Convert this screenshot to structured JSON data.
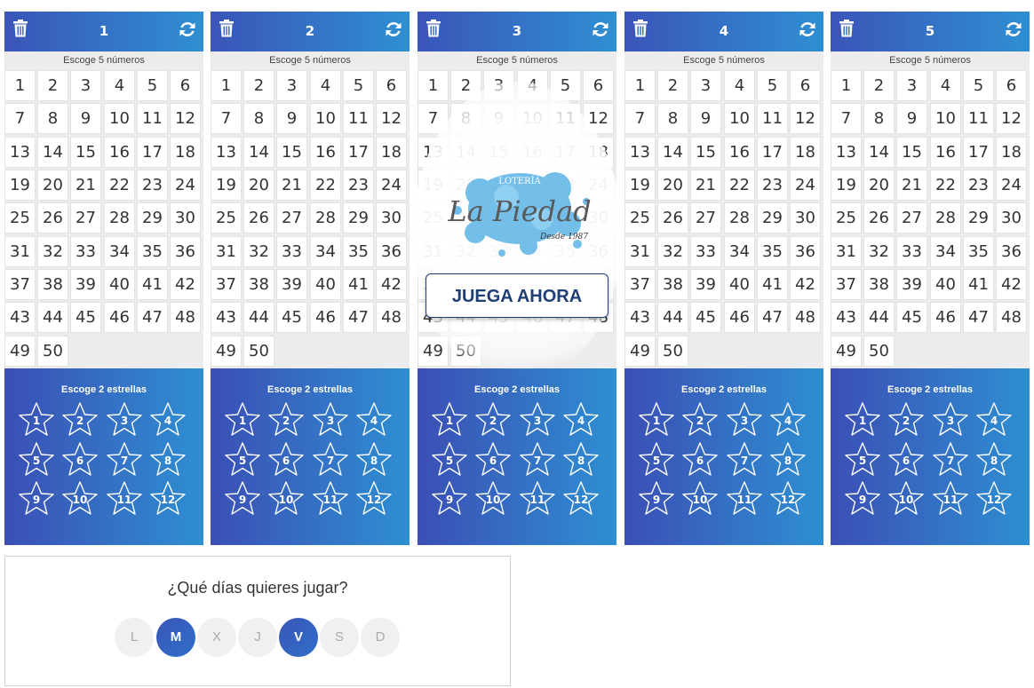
{
  "tickets": [
    {
      "number": "1",
      "pick_numbers_label": "Escoge 5 números",
      "pick_stars_label": "Escoge 2 estrellas"
    },
    {
      "number": "2",
      "pick_numbers_label": "Escoge 5 números",
      "pick_stars_label": "Escoge 2 estrellas"
    },
    {
      "number": "3",
      "pick_numbers_label": "Escoge 5 números",
      "pick_stars_label": "Escoge 2 estrellas"
    },
    {
      "number": "4",
      "pick_numbers_label": "Escoge 5 números",
      "pick_stars_label": "Escoge 2 estrellas"
    },
    {
      "number": "5",
      "pick_numbers_label": "Escoge 5 números",
      "pick_stars_label": "Escoge 2 estrellas"
    }
  ],
  "numbers": [
    "1",
    "2",
    "3",
    "4",
    "5",
    "6",
    "7",
    "8",
    "9",
    "10",
    "11",
    "12",
    "13",
    "14",
    "15",
    "16",
    "17",
    "18",
    "19",
    "20",
    "21",
    "22",
    "23",
    "24",
    "25",
    "26",
    "27",
    "28",
    "29",
    "30",
    "31",
    "32",
    "33",
    "34",
    "35",
    "36",
    "37",
    "38",
    "39",
    "40",
    "41",
    "42",
    "43",
    "44",
    "45",
    "46",
    "47",
    "48",
    "49",
    "50"
  ],
  "stars": [
    "1",
    "2",
    "3",
    "4",
    "5",
    "6",
    "7",
    "8",
    "9",
    "10",
    "11",
    "12"
  ],
  "overlay": {
    "logo_top": "LOTERÍA",
    "logo_main": "La Piedad",
    "logo_since": "Desde 1987",
    "cta": "JUEGA AHORA"
  },
  "days": {
    "question": "¿Qué días quieres jugar?",
    "items": [
      {
        "label": "L",
        "selected": false
      },
      {
        "label": "M",
        "selected": true
      },
      {
        "label": "X",
        "selected": false
      },
      {
        "label": "J",
        "selected": false
      },
      {
        "label": "V",
        "selected": true
      },
      {
        "label": "S",
        "selected": false
      },
      {
        "label": "D",
        "selected": false
      }
    ]
  },
  "colors": {
    "header_start": "#3a55b8",
    "header_end": "#2f8fd3",
    "cta_text": "#1e3e75",
    "grid_bg": "#ececec"
  },
  "icons": {
    "clear": "trash-icon",
    "random": "refresh-icon",
    "star": "star-icon"
  }
}
